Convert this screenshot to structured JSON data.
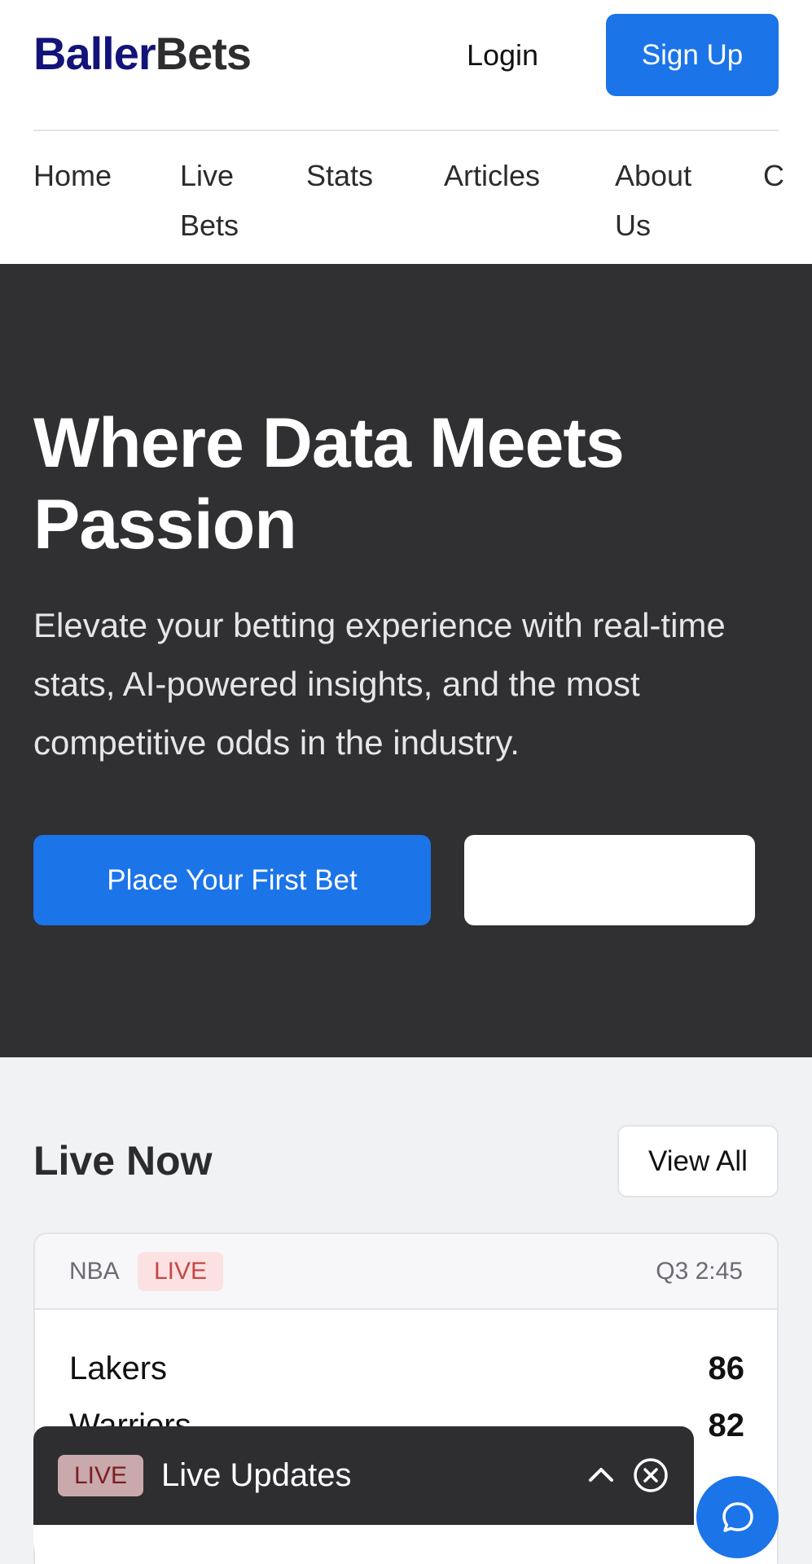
{
  "header": {
    "logo_part1": "Baller",
    "logo_part2": "Bets",
    "login_label": "Login",
    "signup_label": "Sign Up"
  },
  "nav": {
    "items": [
      {
        "label": "Home"
      },
      {
        "label": "Live Bets"
      },
      {
        "label": "Stats"
      },
      {
        "label": "Articles"
      },
      {
        "label": "About Us"
      },
      {
        "label": "C"
      }
    ]
  },
  "hero": {
    "title": "Where Data Meets Passion",
    "subtitle": "Elevate your betting experience with real-time stats, AI-powered insights, and the most competitive odds in the industry.",
    "primary_cta": "Place Your First Bet",
    "secondary_cta": ""
  },
  "live_now": {
    "title": "Live Now",
    "view_all_label": "View All",
    "games": [
      {
        "league": "NBA",
        "badge": "LIVE",
        "clock": "Q3 2:45",
        "teams": [
          {
            "name": "Lakers",
            "score": "86"
          },
          {
            "name": "Warriors",
            "score": "82"
          }
        ]
      }
    ]
  },
  "live_panel": {
    "badge": "LIVE",
    "title": "Live Updates",
    "collapse_icon": "chevron-up-icon",
    "close_icon": "close-circle-icon"
  },
  "chat": {
    "icon": "chat-bubble-icon"
  },
  "colors": {
    "primary_blue": "#1b74e8",
    "logo_navy": "#13137a",
    "hero_bg": "#303032",
    "live_red": "#c74646",
    "page_bg": "#f1f2f4"
  }
}
